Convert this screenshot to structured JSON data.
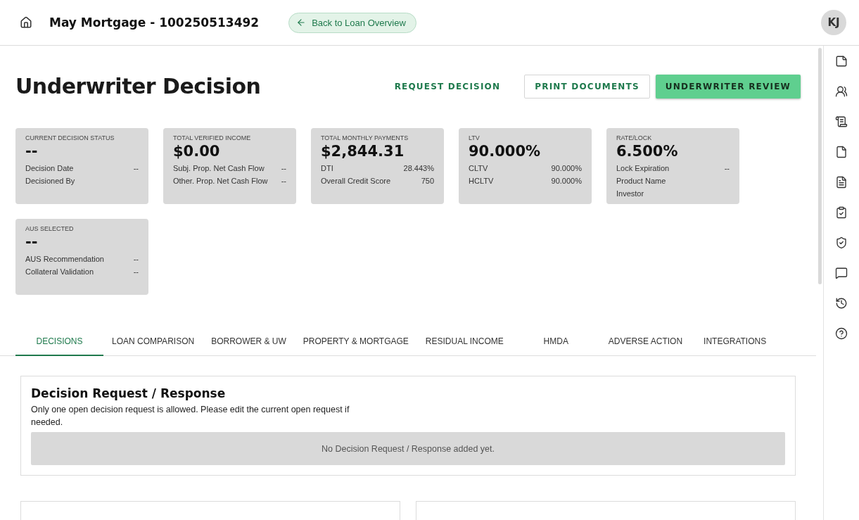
{
  "header": {
    "title": "May Mortgage - 100250513492",
    "back_button": "Back to Loan Overview",
    "avatar": "KJ"
  },
  "page_title": "Underwriter Decision",
  "actions": [
    {
      "label": "REQUEST DECISION",
      "kind": "text"
    },
    {
      "label": "PRINT DOCUMENTS",
      "kind": "outlined"
    },
    {
      "label": "UNDERWRITER REVIEW",
      "kind": "filled"
    }
  ],
  "summary_cards": [
    {
      "label": "CURRENT DECISION STATUS",
      "value": "--",
      "rows": [
        {
          "label": "Decision Date",
          "value": "--"
        },
        {
          "label": "Decisioned By"
        }
      ]
    },
    {
      "label": "TOTAL VERIFIED INCOME",
      "value": "$0.00",
      "rows": [
        {
          "label": "Subj. Prop. Net Cash Flow",
          "value": "--"
        },
        {
          "label": "Other. Prop. Net Cash Flow",
          "value": "--"
        }
      ]
    },
    {
      "label": "TOTAL MONTHLY PAYMENTS",
      "value": "$2,844.31",
      "rows": [
        {
          "label": "DTI",
          "value": "28.443%"
        },
        {
          "label": "Overall Credit Score",
          "value": "750"
        }
      ]
    },
    {
      "label": "LTV",
      "value": "90.000%",
      "rows": [
        {
          "label": "CLTV",
          "value": "90.000%"
        },
        {
          "label": "HCLTV",
          "value": "90.000%"
        }
      ]
    },
    {
      "label": "RATE/LOCK",
      "value": "6.500%",
      "rows": [
        {
          "label": "Lock Expiration",
          "value": "--"
        },
        {
          "label": "Product Name"
        },
        {
          "label": "Investor"
        }
      ]
    },
    {
      "label": "AUS SELECTED",
      "value": "--",
      "rows": [
        {
          "label": "AUS Recommendation",
          "value": "--"
        },
        {
          "label": "Collateral Validation",
          "value": "--"
        }
      ]
    }
  ],
  "tabs": [
    {
      "label": "DECISIONS",
      "selected": true
    },
    {
      "label": "LOAN COMPARISON",
      "selected": false
    },
    {
      "label": "BORROWER & UW",
      "selected": false
    },
    {
      "label": "PROPERTY & MORTGAGE",
      "selected": false
    },
    {
      "label": "RESIDUAL INCOME",
      "selected": false
    },
    {
      "label": "HMDA",
      "selected": false
    },
    {
      "label": "ADVERSE ACTION",
      "selected": false
    },
    {
      "label": "INTEGRATIONS",
      "selected": false
    }
  ],
  "decision_section": {
    "title": "Decision Request / Response",
    "note": "Only one open decision request is allowed. Please edit the current open request if needed.",
    "empty_message": "No Decision Request / Response added yet."
  },
  "comment_panels": [
    {
      "kind": "panel"
    },
    {
      "kind": "panel"
    }
  ],
  "side_rail": [
    {
      "kind": "notes"
    },
    {
      "kind": "people"
    },
    {
      "kind": "receipt"
    },
    {
      "kind": "file"
    },
    {
      "kind": "document"
    },
    {
      "kind": "clipboard"
    },
    {
      "kind": "shield"
    },
    {
      "kind": "message"
    },
    {
      "kind": "history"
    },
    {
      "kind": "help"
    }
  ]
}
